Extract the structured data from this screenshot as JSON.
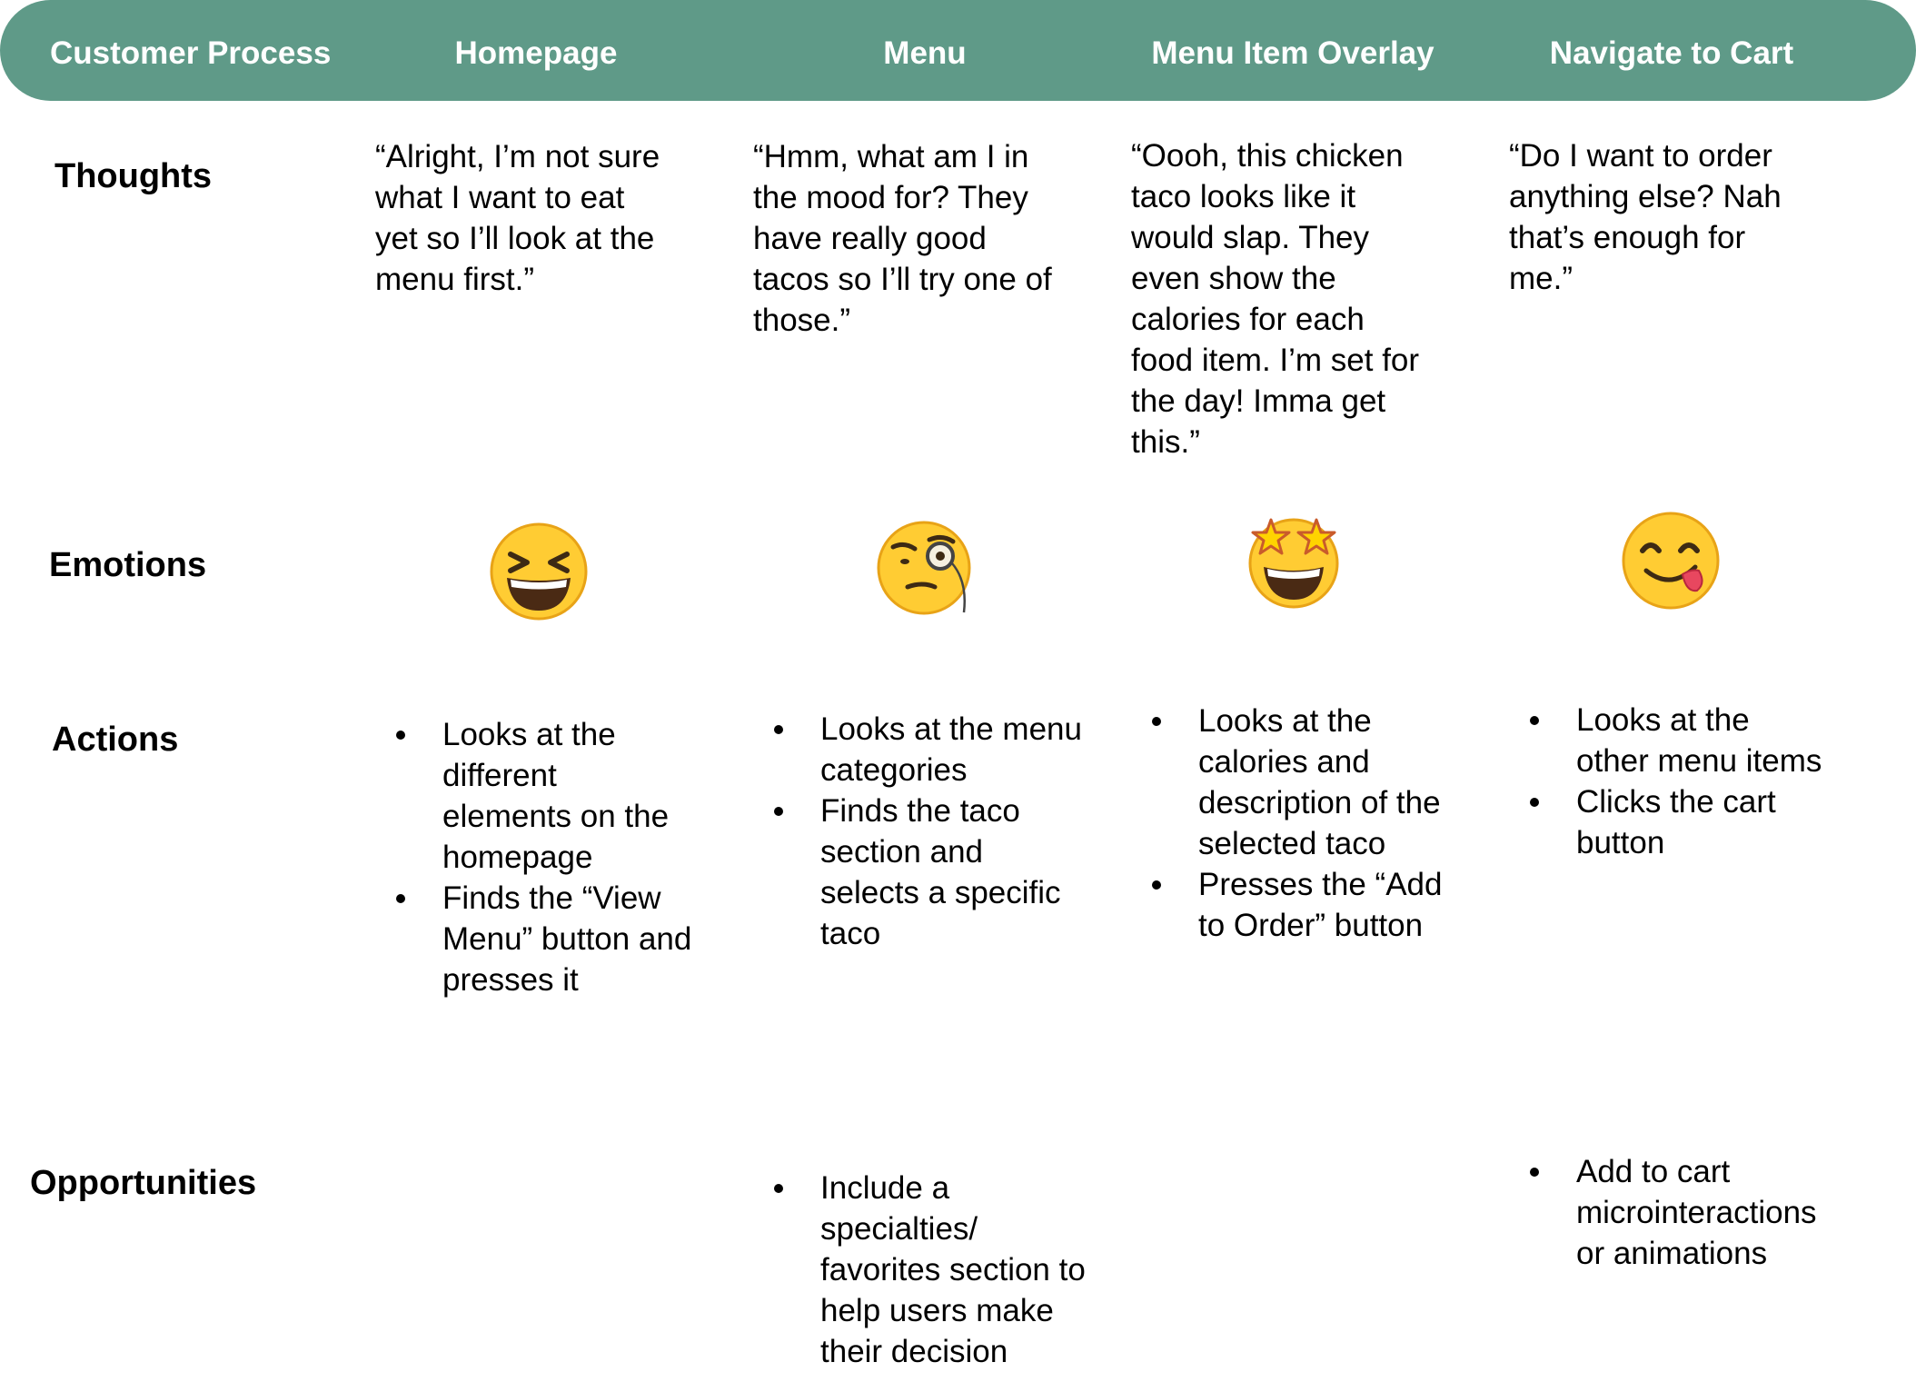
{
  "header": {
    "columns": [
      "Customer Process",
      "Homepage",
      "Menu",
      "Menu Item Overlay",
      "Navigate to Cart"
    ]
  },
  "rows": {
    "thoughts": "Thoughts",
    "emotions": "Emotions",
    "actions": "Actions",
    "opportunities": "Opportunities"
  },
  "thoughts": [
    "“Alright, I’m not sure\nwhat I want to eat\nyet so I’ll look at the\nmenu first.”",
    "“Hmm, what am I in\nthe mood for? They\nhave really good\ntacos so I’ll try one of\nthose.”",
    "“Oooh, this chicken\ntaco looks like it\nwould slap. They\neven show the\ncalories for each\nfood item. I’m set for\nthe day! Imma get\nthis.”",
    "“Do I want to order\nanything else? Nah\nthat’s enough for\nme.”"
  ],
  "emotions": [
    "grinning-squinting-face-icon",
    "face-with-monocle-icon",
    "star-struck-face-icon",
    "face-savoring-food-icon"
  ],
  "actions": [
    [
      "Looks at the\ndifferent\nelements on the\nhomepage",
      "Finds the “View\nMenu” button and\npresses it"
    ],
    [
      "Looks at the menu\ncategories",
      "Finds the taco\nsection and\nselects a specific\ntaco"
    ],
    [
      "Looks at the\ncalories and\ndescription of the\nselected taco",
      "Presses the “Add\nto Order” button"
    ],
    [
      "Looks at the\nother menu items",
      "Clicks the cart\nbutton"
    ]
  ],
  "opportunities": {
    "menu": [
      "Include a\nspecialties/\nfavorites section to\nhelp users make\ntheir decision"
    ],
    "cart": [
      "Add to cart\nmicrointeractions\nor animations"
    ]
  },
  "colors": {
    "header_background": "#5f9a88",
    "header_text": "#ffffff",
    "body_text": "#000000"
  }
}
